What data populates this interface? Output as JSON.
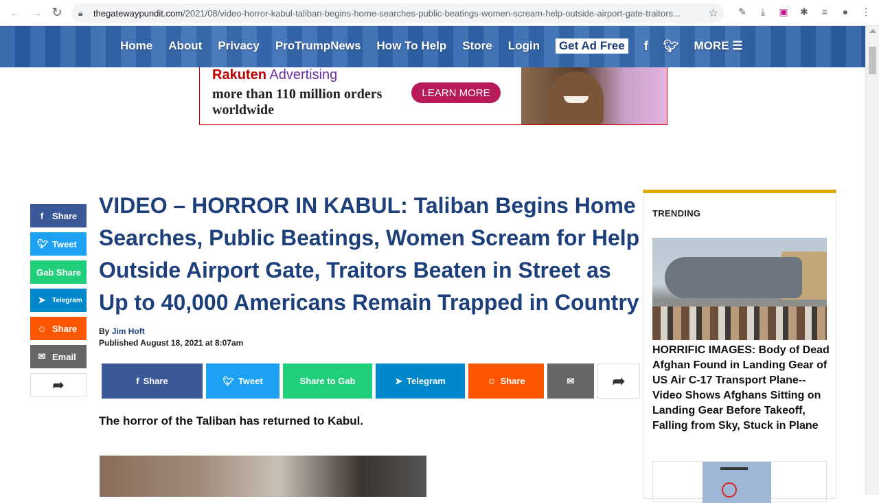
{
  "browser": {
    "url_host": "thegatewaypundit.com",
    "url_path": "/2021/08/video-horror-kabul-taliban-begins-home-searches-public-beatings-women-scream-help-outside-airport-gate-traitors..."
  },
  "nav": {
    "items": [
      "Home",
      "About",
      "Privacy",
      "ProTrumpNews",
      "How To Help",
      "Store",
      "Login"
    ],
    "ad_free": "Get Ad Free",
    "more": "MORE"
  },
  "ad": {
    "brand_a": "Rakuten",
    "brand_b": "Advertising",
    "line1": "more than 110 million orders",
    "line2": "worldwide",
    "cta": "LEARN MORE"
  },
  "rail": [
    {
      "label": "Share",
      "color": "#3b5998",
      "icon": "f"
    },
    {
      "label": "Tweet",
      "color": "#1da1f2",
      "icon": "t"
    },
    {
      "label": "Gab Share",
      "color": "#21cf7a",
      "icon": ""
    },
    {
      "label": "Telegram",
      "color": "#0088cc",
      "icon": "➤"
    },
    {
      "label": "Share",
      "color": "#ff5700",
      "icon": "☺"
    },
    {
      "label": "Email",
      "color": "#666666",
      "icon": "✉"
    }
  ],
  "article": {
    "headline": "VIDEO – HORROR IN KABUL: Taliban Begins Home Searches, Public Beatings, Women Scream for Help Outside Airport Gate, Traitors Beaten in Street as Up to 40,000 Americans Remain Trapped in Country",
    "by": "By",
    "author": "Jim Hoft",
    "published": "Published August 18, 2021 at 8:07am",
    "lead": "The horror of the Taliban has returned to Kabul."
  },
  "sharebar": [
    {
      "label": "Share",
      "color": "#3b5998",
      "icon": "f"
    },
    {
      "label": "Tweet",
      "color": "#1da1f2",
      "icon": "t"
    },
    {
      "label": "Share to Gab",
      "color": "#21cf7a",
      "icon": ""
    },
    {
      "label": "Telegram",
      "color": "#0088cc",
      "icon": "➤"
    },
    {
      "label": "Share",
      "color": "#ff5700",
      "icon": "☺"
    }
  ],
  "sidebar": {
    "title": "TRENDING",
    "story": "HORRIFIC IMAGES: Body of Dead Afghan Found in Landing Gear of US Air C-17 Transport Plane-- Video Shows Afghans Sitting on Landing Gear Before Takeoff, Falling from Sky, Stuck in Plane"
  }
}
